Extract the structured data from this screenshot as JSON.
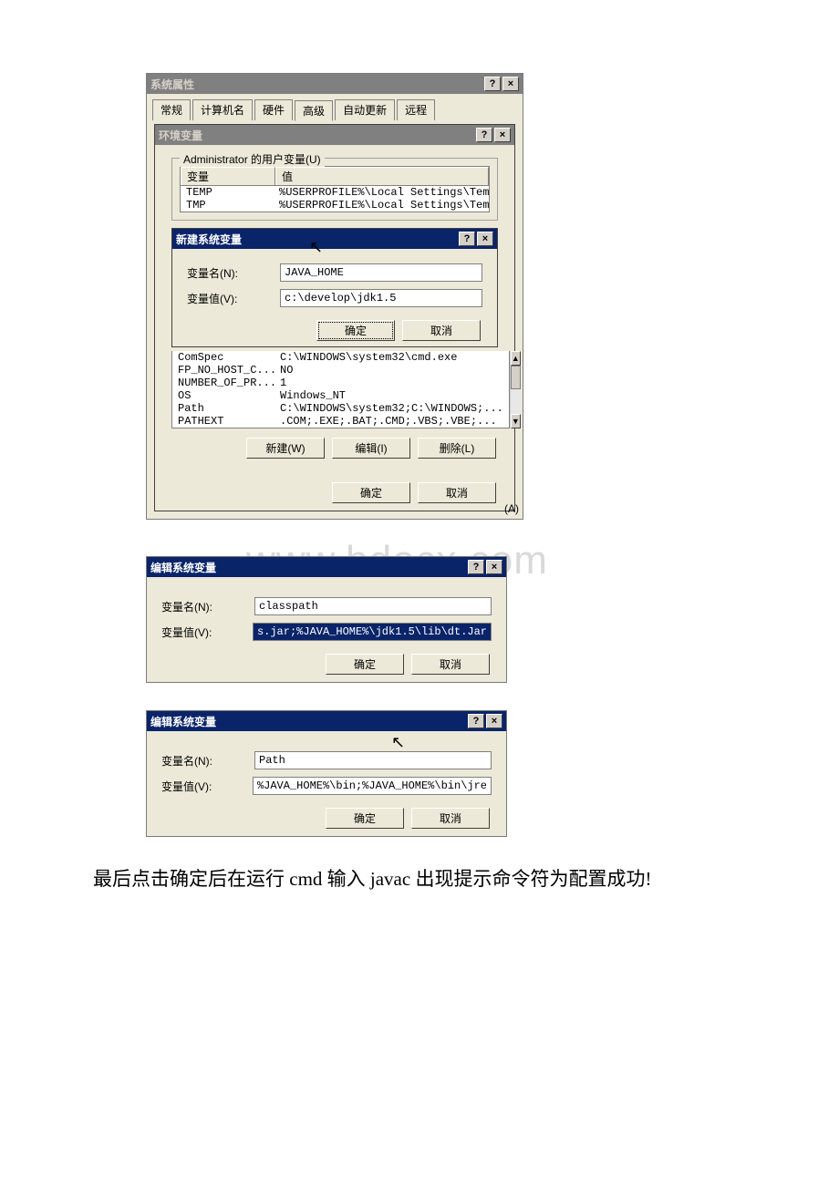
{
  "watermark": "www.bdocx.com",
  "sysprops": {
    "title": "系统属性",
    "tabs": [
      "常规",
      "计算机名",
      "硬件",
      "高级",
      "自动更新",
      "远程"
    ],
    "active_tab": "高级"
  },
  "envvar": {
    "title": "环境变量",
    "user_section": "Administrator 的用户变量(U)",
    "col_var": "变量",
    "col_val": "值",
    "user_rows": [
      {
        "k": "TEMP",
        "v": "%USERPROFILE%\\Local Settings\\Temp"
      },
      {
        "k": "TMP",
        "v": "%USERPROFILE%\\Local Settings\\Temp"
      }
    ],
    "sys_rows": [
      {
        "k": "ComSpec",
        "v": "C:\\WINDOWS\\system32\\cmd.exe"
      },
      {
        "k": "FP_NO_HOST_C...",
        "v": "NO"
      },
      {
        "k": "NUMBER_OF_PR...",
        "v": "1"
      },
      {
        "k": "OS",
        "v": "Windows_NT"
      },
      {
        "k": "Path",
        "v": "C:\\WINDOWS\\system32;C:\\WINDOWS;..."
      },
      {
        "k": "PATHEXT",
        "v": ".COM;.EXE;.BAT;.CMD;.VBS;.VBE;..."
      }
    ],
    "btn_new": "新建(W)",
    "btn_edit": "编辑(I)",
    "btn_delete": "删除(L)",
    "btn_ok": "确定",
    "btn_cancel": "取消",
    "btn_apply": "(A)"
  },
  "newsysvar": {
    "title": "新建系统变量",
    "label_name": "变量名(N):",
    "label_value": "变量值(V):",
    "name": "JAVA_HOME",
    "value": "c:\\develop\\jdk1.5",
    "btn_ok": "确定",
    "btn_cancel": "取消"
  },
  "editclasspath": {
    "title": "编辑系统变量",
    "label_name": "变量名(N):",
    "label_value": "变量值(V):",
    "name": "classpath",
    "value": "s.jar;%JAVA_HOME%\\jdk1.5\\lib\\dt.Jar",
    "btn_ok": "确定",
    "btn_cancel": "取消"
  },
  "editpath": {
    "title": "编辑系统变量",
    "label_name": "变量名(N):",
    "label_value": "变量值(V):",
    "name": "Path",
    "value": "%JAVA_HOME%\\bin;%JAVA_HOME%\\bin\\jre",
    "btn_ok": "确定",
    "btn_cancel": "取消"
  },
  "caption": "最后点击确定后在运行 cmd 输入 javac 出现提示命令符为配置成功!"
}
